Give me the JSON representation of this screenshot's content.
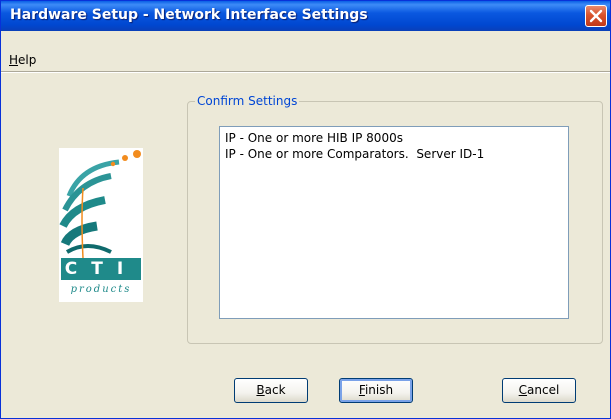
{
  "window": {
    "title": "Hardware Setup - Network Interface Settings"
  },
  "menu": {
    "help": {
      "accel": "H",
      "rest": "elp"
    }
  },
  "group": {
    "title": "Confirm Settings",
    "items": [
      "IP - One or more HIB IP 8000s",
      "IP - One or more Comparators.  Server ID-1"
    ]
  },
  "logo": {
    "text_top": "CTI",
    "text_bottom": "products"
  },
  "buttons": {
    "back": {
      "accel": "B",
      "rest": "ack"
    },
    "finish": {
      "accel": "F",
      "rest": "inish"
    },
    "cancel": {
      "accel": "C",
      "rest": "ancel"
    }
  },
  "colors": {
    "titlebar": "#0054e3",
    "close": "#d9532c",
    "group_title": "#0046d5",
    "logo_teal": "#1f8a8a",
    "logo_orange": "#f28c1e"
  }
}
